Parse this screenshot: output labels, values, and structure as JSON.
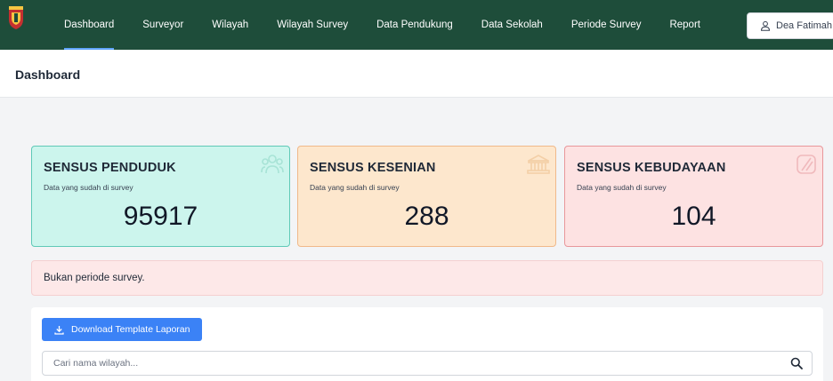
{
  "nav": {
    "items": [
      {
        "label": "Dashboard",
        "active": true
      },
      {
        "label": "Surveyor"
      },
      {
        "label": "Wilayah"
      },
      {
        "label": "Wilayah Survey"
      },
      {
        "label": "Data Pendukung"
      },
      {
        "label": "Data Sekolah"
      },
      {
        "label": "Periode Survey"
      },
      {
        "label": "Report"
      }
    ],
    "user_name": "Dea Fatimah"
  },
  "page": {
    "title": "Dashboard"
  },
  "cards": [
    {
      "title": "SENSUS PENDUDUK",
      "subtitle": "Data yang sudah di survey",
      "value": "95917",
      "icon": "users-icon",
      "color": "#ccf5ed"
    },
    {
      "title": "SENSUS KESENIAN",
      "subtitle": "Data yang sudah di survey",
      "value": "288",
      "icon": "museum-icon",
      "color": "#fde7cd"
    },
    {
      "title": "SENSUS KEBUDAYAAN",
      "subtitle": "Data yang sudah di survey",
      "value": "104",
      "icon": "culture-icon",
      "color": "#fde2e2"
    }
  ],
  "alert": {
    "text": "Bukan periode survey."
  },
  "actions": {
    "download_label": "Download Template Laporan"
  },
  "search": {
    "placeholder": "Cari nama wilayah..."
  },
  "colors": {
    "navbar": "#1e4d3a",
    "primary": "#3b82f6",
    "alert_bg": "#fde8e8"
  }
}
